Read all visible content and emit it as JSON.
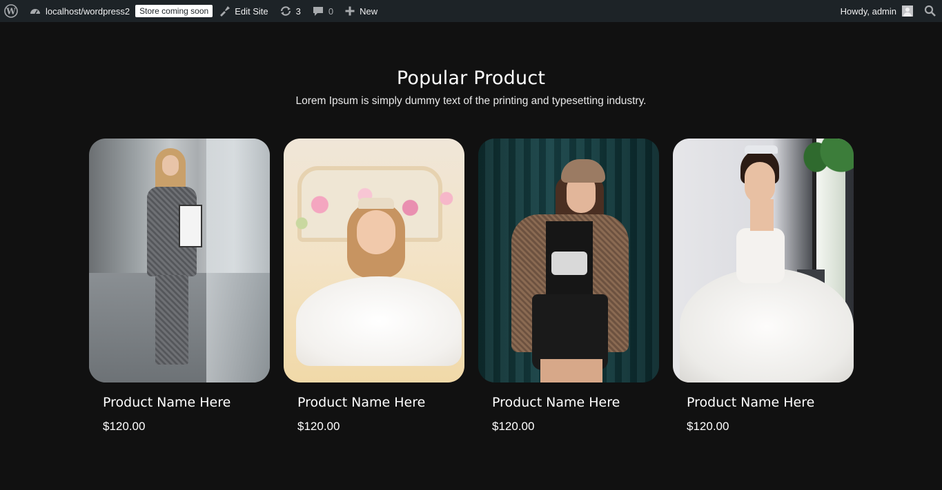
{
  "adminbar": {
    "site_name": "localhost/wordpress2",
    "store_badge": "Store coming soon",
    "edit_site": "Edit Site",
    "updates_count": "3",
    "comments_count": "0",
    "new_label": "New",
    "howdy": "Howdy, admin"
  },
  "section": {
    "title": "Popular Product",
    "subtitle": "Lorem Ipsum is simply dummy text of the printing and typesetting industry."
  },
  "products": [
    {
      "name": "Product Name Here",
      "price": "$120.00"
    },
    {
      "name": "Product Name Here",
      "price": "$120.00"
    },
    {
      "name": "Product Name Here",
      "price": "$120.00"
    },
    {
      "name": "Product Name Here",
      "price": "$120.00"
    }
  ],
  "icons": [
    "wordpress-logo-icon",
    "dashboard-icon",
    "edit-brush-icon",
    "updates-icon",
    "comment-icon",
    "plus-icon",
    "search-icon"
  ],
  "colors": {
    "page_bg": "#111111",
    "adminbar_bg": "#1d2327",
    "text": "#ffffff"
  }
}
